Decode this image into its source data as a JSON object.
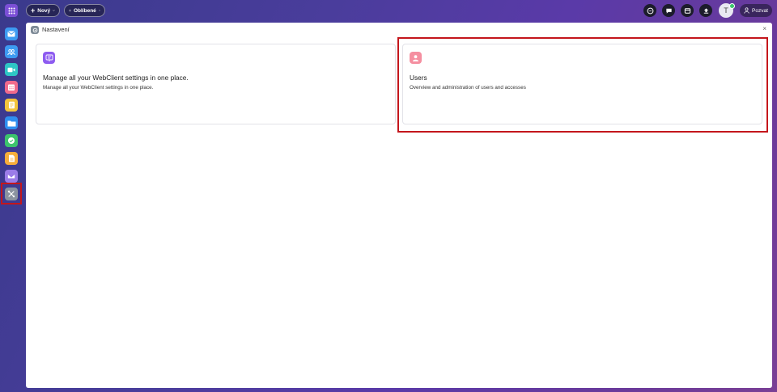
{
  "toolbar": {
    "new_label": "Nový",
    "favorites_label": "Oblíbené",
    "avatar_initial": "T",
    "invite_label": "Pozvat"
  },
  "sidebar": {
    "items": [
      {
        "icon": "mail-icon",
        "color": "#3d9bf2"
      },
      {
        "icon": "contacts-icon",
        "color": "#3d9bf2"
      },
      {
        "icon": "video-icon",
        "color": "#2ec5c5"
      },
      {
        "icon": "calendar-icon",
        "color": "#f06a8c"
      },
      {
        "icon": "notes-icon",
        "color": "#f3c43c"
      },
      {
        "icon": "files-icon",
        "color": "#2f8ff0"
      },
      {
        "icon": "tasks-icon",
        "color": "#3cc46d"
      },
      {
        "icon": "documents-icon",
        "color": "#f6ad3b"
      },
      {
        "icon": "inbox-icon",
        "color": "#9b7ce8"
      },
      {
        "icon": "settings-icon",
        "color": "#8b93a0"
      }
    ]
  },
  "window": {
    "title": "Nastavení",
    "close": "×"
  },
  "cards": [
    {
      "title": "Manage all your WebClient settings in one place.",
      "description": "Manage all your WebClient settings in one place.",
      "icon": "settings-panel-icon",
      "icon_color": "#8e5cf0"
    },
    {
      "title": "Users",
      "description": "Overview and administration of users and accesses",
      "icon": "user-icon",
      "icon_color": "#f58fa0"
    }
  ],
  "colors": {
    "highlight": "#c4161c"
  }
}
